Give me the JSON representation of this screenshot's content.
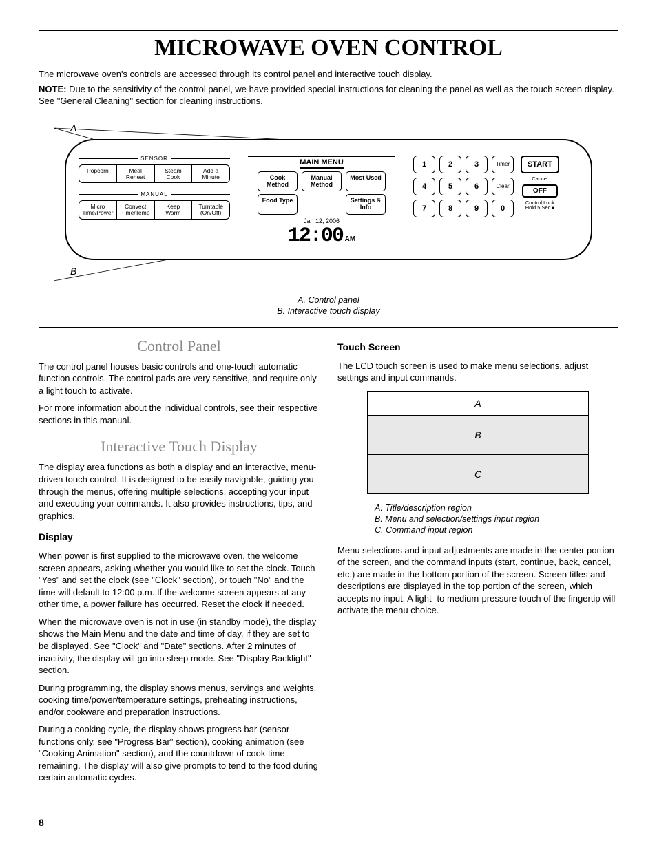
{
  "title": "MICROWAVE OVEN CONTROL",
  "intro": {
    "p1": "The microwave oven's controls are accessed through its control panel and interactive touch display.",
    "note_label": "NOTE:",
    "p2": " Due to the sensitivity of the control panel, we have provided special instructions for cleaning the panel as well as the touch screen display. See \"General Cleaning\" section for cleaning instructions."
  },
  "diagram": {
    "label_A": "A",
    "label_B": "B",
    "sensor_legend": "SENSOR",
    "sensor_buttons": [
      "Popcorn",
      "Meal\nReheat",
      "Steam\nCook",
      "Add a\nMinute"
    ],
    "manual_legend": "MANUAL",
    "manual_buttons": [
      "Micro\nTime/Power",
      "Convect\nTime/Temp",
      "Keep\nWarm",
      "Turntable\n(On/Off)"
    ],
    "main_menu_label": "MAIN MENU",
    "menu_row1": [
      "Cook\nMethod",
      "Manual\nMethod",
      "Most Used"
    ],
    "menu_row2": [
      "Food Type",
      "",
      "Settings &\nInfo"
    ],
    "date": "Jan 12, 2006",
    "clock": "12:00",
    "ampm": "AM",
    "keys": [
      "1",
      "2",
      "3",
      "Timer",
      "4",
      "5",
      "6",
      "Clear",
      "7",
      "8",
      "9",
      "0"
    ],
    "start": "START",
    "cancel": "Cancel",
    "off": "OFF",
    "lock": "Control Lock\nHold 5 Sec"
  },
  "caption": {
    "a": "A. Control panel",
    "b": "B. Interactive touch display"
  },
  "left_col": {
    "h_control": "Control Panel",
    "cp_p1": "The control panel houses basic controls and one-touch automatic function controls. The control pads are very sensitive, and require only a light touch to activate.",
    "cp_p2": "For more information about the individual controls, see their respective sections in this manual.",
    "h_itd": "Interactive Touch Display",
    "itd_p1": "The display area functions as both a display and an interactive, menu-driven touch control. It is designed to be easily navigable, guiding you through the menus, offering multiple selections, accepting your input and executing your commands. It also provides instructions, tips, and graphics.",
    "sub_display": "Display",
    "d_p1": "When power is first supplied to the microwave oven, the welcome screen appears, asking whether you would like to set the clock. Touch \"Yes\" and set the clock (see \"Clock\" section), or touch \"No\" and the time will default to 12:00 p.m. If the welcome screen appears at any other time, a power failure has occurred. Reset the clock if needed.",
    "d_p2": "When the microwave oven is not in use (in standby mode), the display shows the Main Menu and the date and time of day, if they are set to be displayed. See \"Clock\" and \"Date\" sections. After 2 minutes of inactivity, the display will go into sleep mode. See \"Display Backlight\" section.",
    "d_p3": "During programming, the display shows menus, servings and weights, cooking time/power/temperature settings, preheating instructions, and/or cookware and preparation instructions.",
    "d_p4": "During a cooking cycle, the display shows progress bar (sensor functions only, see \"Progress Bar\" section), cooking animation (see \"Cooking Animation\" section), and the countdown of cook time remaining. The display will also give prompts to tend to the food during certain automatic cycles."
  },
  "right_col": {
    "sub_ts": "Touch Screen",
    "ts_p1": "The LCD touch screen is used to make menu selections, adjust settings and input commands.",
    "ts_A": "A",
    "ts_B": "B",
    "ts_C": "C",
    "ts_cap_a": "A. Title/description region",
    "ts_cap_b": "B. Menu and selection/settings input region",
    "ts_cap_c": "C. Command input region",
    "ts_p2": "Menu selections and input adjustments are made in the center portion of the screen, and the command inputs (start, continue, back, cancel, etc.) are made in the bottom portion of the screen. Screen titles and descriptions are displayed in the top portion of the screen, which accepts no input. A light- to medium-pressure touch of the fingertip will activate the menu choice."
  },
  "page_num": "8"
}
